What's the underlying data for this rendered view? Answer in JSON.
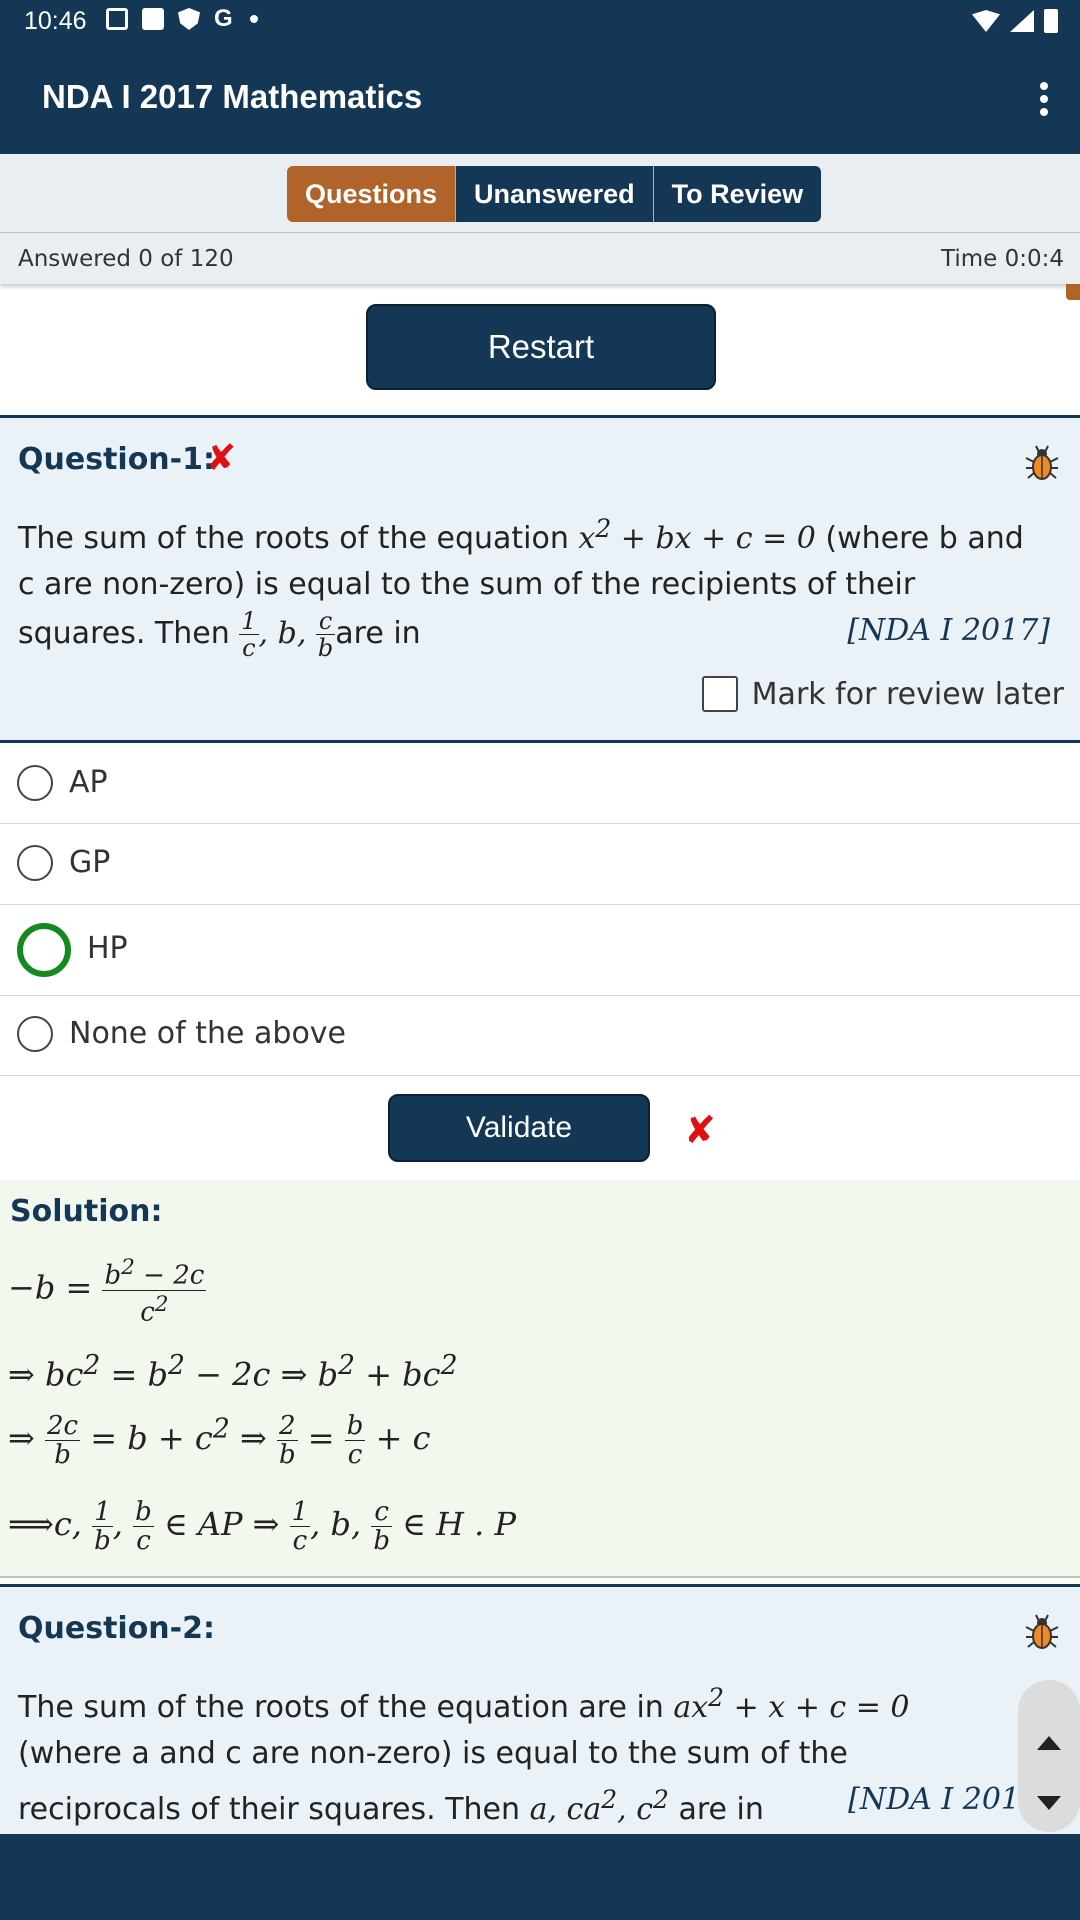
{
  "status_bar": {
    "time": "10:46"
  },
  "app": {
    "title": "NDA I 2017 Mathematics"
  },
  "tabs": [
    {
      "label": "Questions",
      "active": true
    },
    {
      "label": "Unanswered",
      "active": false
    },
    {
      "label": "To Review",
      "active": false
    }
  ],
  "progress": {
    "answered_text": "Answered 0 of 120",
    "time_text": "Time 0:0:4"
  },
  "restart_label": "Restart",
  "question1": {
    "title": "Question-1:",
    "text_part1": "The sum of the roots of the equation",
    "text_part2": "(where b and c are non-zero) is equal to the sum of the recipients of their squares. Then",
    "text_part3": "are in",
    "source": "[NDA I 2017]",
    "review_label": "Mark for review later",
    "options": [
      "AP",
      "GP",
      "HP",
      "None of the above"
    ],
    "selected_option": "HP"
  },
  "validate_label": "Validate",
  "solution": {
    "title": "Solution:"
  },
  "question2": {
    "title": "Question-2:",
    "text_part1": "The sum of the roots of the equation are in",
    "text_part2": "(where a and c are non-zero) is equal to the sum of the reciprocals of their squares. Then",
    "text_part3": "are in",
    "source": "[NDA I 201"
  },
  "colors": {
    "primary": "#143756",
    "accent": "#b0642a",
    "error": "#e01010",
    "selected": "#128a1e",
    "question_bg": "#eaf1f7",
    "solution_bg": "#f2f8ee"
  }
}
